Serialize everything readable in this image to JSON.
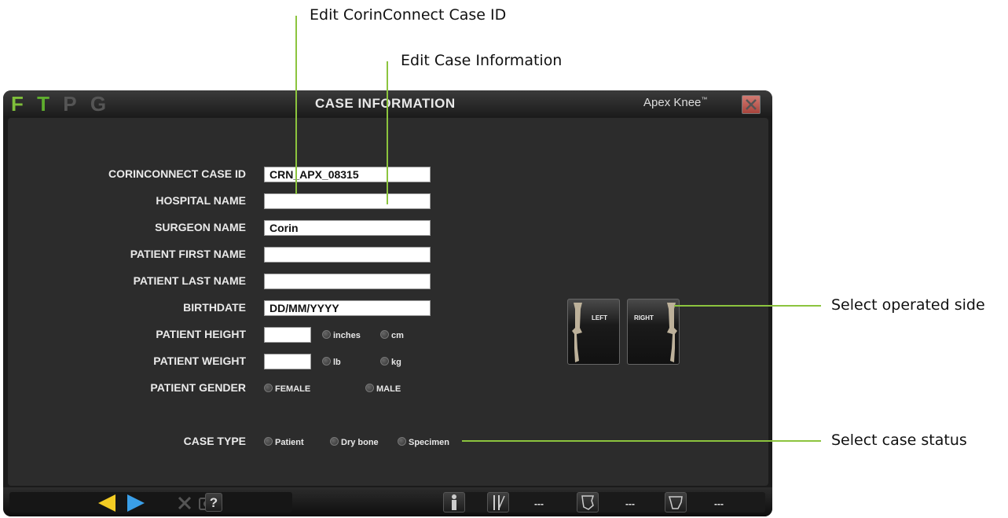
{
  "callouts": {
    "case_id": "Edit CorinConnect Case ID",
    "case_info": "Edit Case Information",
    "operated_side": "Select operated side",
    "case_status": "Select case status"
  },
  "window": {
    "logo_letters": [
      "F",
      "T",
      "P",
      "G"
    ],
    "title": "CASE INFORMATION",
    "brand": "Apex Knee",
    "brand_mark": "™"
  },
  "form": {
    "case_id_label": "CORINCONNECT CASE ID",
    "case_id_value": "CRN_APX_08315",
    "hospital_label": "HOSPITAL NAME",
    "hospital_value": "",
    "surgeon_label": "SURGEON NAME",
    "surgeon_value": "Corin",
    "first_name_label": "PATIENT FIRST NAME",
    "first_name_value": "",
    "last_name_label": "PATIENT LAST NAME",
    "last_name_value": "",
    "birthdate_label": "BIRTHDATE",
    "birthdate_value": "DD/MM/YYYY",
    "height_label": "PATIENT HEIGHT",
    "height_value": "",
    "height_units": [
      "inches",
      "cm"
    ],
    "weight_label": "PATIENT WEIGHT",
    "weight_value": "",
    "weight_units": [
      "lb",
      "kg"
    ],
    "gender_label": "PATIENT GENDER",
    "gender_options": [
      "FEMALE",
      "MALE"
    ],
    "case_type_label": "CASE TYPE",
    "case_type_options": [
      "Patient",
      "Dry bone",
      "Specimen"
    ]
  },
  "side": {
    "left_label": "LEFT",
    "right_label": "RIGHT"
  },
  "bottom": {
    "help_label": "?",
    "values": [
      "---",
      "---",
      "---"
    ]
  },
  "colors": {
    "accent_green": "#8cc43e",
    "logo_f": "#7fbf3a",
    "logo_t": "#5fae2e",
    "logo_dim": "#555555",
    "arrow_back": "#f4cc23",
    "arrow_next": "#3a9fe8"
  }
}
